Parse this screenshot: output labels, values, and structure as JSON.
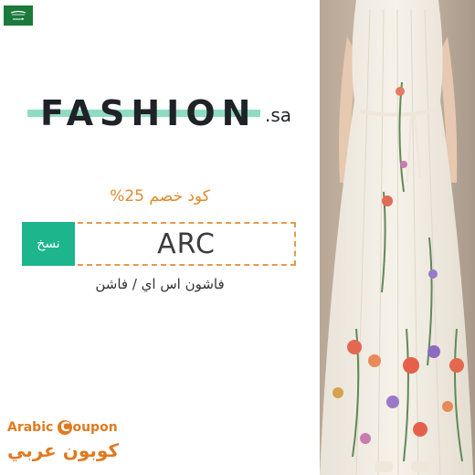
{
  "flag": {
    "icon": "saudi-flag-icon",
    "text": "لا إله إلا الله"
  },
  "logo": {
    "word": "FASHION",
    "tld": ".sa",
    "accent": "#8fdcc3"
  },
  "coupon": {
    "discount": "كود خصم 25%",
    "code": "ARC",
    "copy_label": "نسخ",
    "store": "فاشون اس اي / فاشن"
  },
  "brand": {
    "en_prefix": "Arabic ",
    "en_suffix": "oupon",
    "en_c": "C",
    "ar": "كوبون عربي"
  },
  "photo": {
    "icon": "floral-dress-photo"
  },
  "colors": {
    "accent": "#e08a2f",
    "copy": "#1db58b",
    "border": "#e59a4c"
  }
}
